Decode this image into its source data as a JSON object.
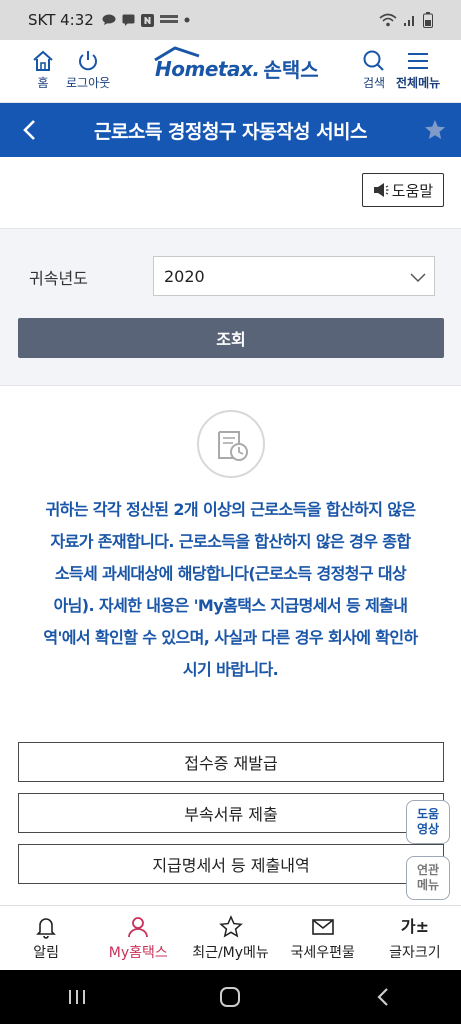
{
  "statusbar": {
    "carrier": "SKT 4:32"
  },
  "header": {
    "home_label": "홈",
    "logout_label": "로그아웃",
    "logo_home": "Hometax.",
    "logo_son": "손택스",
    "search_label": "검색",
    "menu_label": "전체메뉴"
  },
  "titlebar": {
    "title": "근로소득 경정청구 자동작성 서비스"
  },
  "help": {
    "label": "도움말"
  },
  "search": {
    "year_label": "귀속년도",
    "year_value": "2020",
    "query_label": "조회"
  },
  "message": {
    "lines": [
      "귀하는 각각 정산된 2개 이상의 근로소득을 합산하지 않은",
      "자료가 존재합니다. 근로소득을 합산하지 않은 경우 종합",
      "소득세 과세대상에 해당합니다(근로소득 경정청구 대상",
      "아님). 자세한 내용은 'My홈택스 지급명세서 등 제출내",
      "역'에서 확인할 수 있으며, 사실과 다른 경우 회사에 확인하",
      "시기 바랍니다."
    ]
  },
  "actions": {
    "receipt": "접수증 재발급",
    "attachments": "부속서류 제출",
    "statements": "지급명세서 등 제출내역"
  },
  "floating": {
    "video_line1": "도움",
    "video_line2": "영상",
    "related_line1": "연관",
    "related_line2": "메뉴"
  },
  "bottomnav": {
    "items": [
      {
        "label": "알림",
        "icon": "bell-icon"
      },
      {
        "label": "My홈택스",
        "icon": "person-icon"
      },
      {
        "label": "최근/My메뉴",
        "icon": "star-icon"
      },
      {
        "label": "국세우편물",
        "icon": "mail-icon"
      },
      {
        "label": "글자크기",
        "icon": "font-size-icon",
        "glyph": "가±"
      }
    ]
  },
  "colors": {
    "primary": "#1757b4",
    "query_button": "#5a6478",
    "active_nav": "#c8325a",
    "message_text": "#1a56a7"
  }
}
